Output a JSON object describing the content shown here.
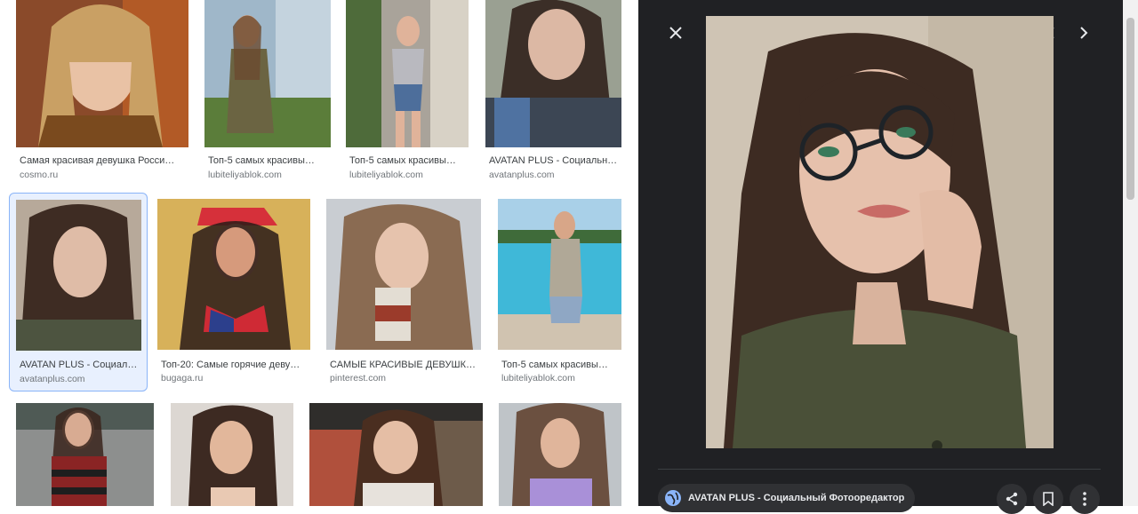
{
  "results": [
    {
      "caption": "Самая красивая девушка Росси…",
      "source": "cosmo.ru"
    },
    {
      "caption": "Топ-5 самых красивы…",
      "source": "lubiteliyablok.com"
    },
    {
      "caption": "Топ-5 самых красивы…",
      "source": "lubiteliyablok.com"
    },
    {
      "caption": "AVATAN PLUS - Социальн…",
      "source": "avatanplus.com"
    },
    {
      "caption": "AVATAN PLUS - Социал…",
      "source": "avatanplus.com"
    },
    {
      "caption": "Топ-20: Самые горячие деву…",
      "source": "bugaga.ru"
    },
    {
      "caption": "САМЫЕ КРАСИВЫЕ ДЕВУШК…",
      "source": "pinterest.com"
    },
    {
      "caption": "Топ-5 самых красивы…",
      "source": "lubiteliyablok.com"
    },
    {
      "caption": "",
      "source": ""
    },
    {
      "caption": "",
      "source": ""
    },
    {
      "caption": "",
      "source": ""
    },
    {
      "caption": "",
      "source": ""
    }
  ],
  "viewer": {
    "source_title": "AVATAN PLUS - Социальный Фотоoредактор",
    "close_icon": "close-icon",
    "prev_icon": "chevron-left-icon",
    "next_icon": "chevron-right-icon",
    "share_icon": "share-icon",
    "save_icon": "bookmark-icon",
    "more_icon": "more-vert-icon",
    "globe_icon": "globe-icon"
  },
  "colors": {
    "viewer_bg": "#202124",
    "selected_border": "#8ab4f8",
    "caption_text": "#3c4043",
    "source_text": "#70757a"
  }
}
